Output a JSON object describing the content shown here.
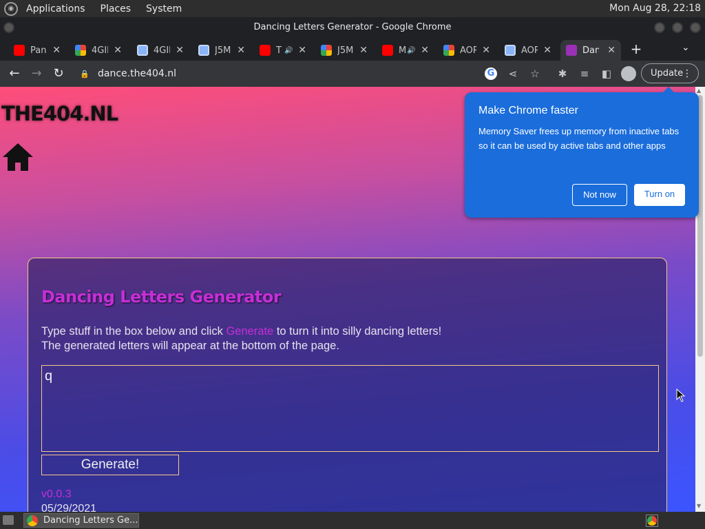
{
  "os_panel": {
    "menus": [
      "Applications",
      "Places",
      "System"
    ],
    "clock": "Mon Aug 28, 22:18"
  },
  "window": {
    "title": "Dancing Letters Generator - Google Chrome"
  },
  "tabs": [
    {
      "title": "Pan",
      "favicon": "youtube-icon",
      "audio": false
    },
    {
      "title": "4GIL",
      "favicon": "pinwheel-icon",
      "audio": false
    },
    {
      "title": "4GIL",
      "favicon": "image-icon",
      "audio": false
    },
    {
      "title": "J5M",
      "favicon": "image-icon",
      "audio": false
    },
    {
      "title": "T",
      "favicon": "youtube-icon",
      "audio": true
    },
    {
      "title": "J5M",
      "favicon": "pinwheel-icon",
      "audio": false
    },
    {
      "title": "M",
      "favicon": "youtube-icon",
      "audio": true
    },
    {
      "title": "AOP",
      "favicon": "pinwheel-icon",
      "audio": false
    },
    {
      "title": "AOP",
      "favicon": "image-icon",
      "audio": false
    },
    {
      "title": "Dan",
      "favicon": "dance-icon",
      "audio": false,
      "active": true
    }
  ],
  "toolbar": {
    "url": "dance.the404.nl",
    "update_label": "Update"
  },
  "page": {
    "site_logo": "THE404.NL",
    "heading": "Dancing Letters Generator",
    "intro_pre": "Type stuff in the box below and click ",
    "intro_highlight": "Generate",
    "intro_post": " to turn it into silly dancing letters!",
    "intro_line2": "The generated letters will appear at the bottom of the page.",
    "textbox_value": "q",
    "generate_label": "Generate!",
    "version": "v0.0.3",
    "date": "05/29/2021",
    "accent_color": "#c62fd6"
  },
  "promo": {
    "title": "Make Chrome faster",
    "body": "Memory Saver frees up memory from inactive tabs so it can be used by active tabs and other apps",
    "not_now_label": "Not now",
    "turn_on_label": "Turn on"
  },
  "taskbar": {
    "task_label": "Dancing Letters Ge..."
  }
}
